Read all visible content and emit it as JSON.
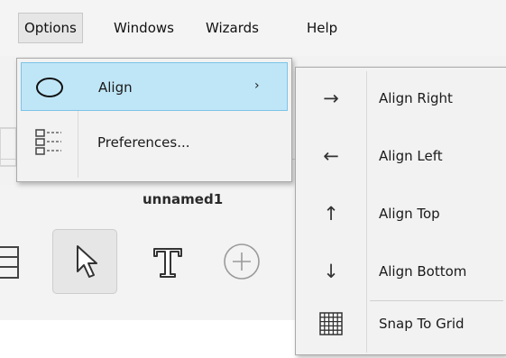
{
  "menubar": {
    "items": [
      {
        "label": "Options",
        "open": true
      },
      {
        "label": "Windows"
      },
      {
        "label": "Wizards"
      },
      {
        "label": "Help"
      }
    ]
  },
  "document": {
    "title": "unnamed1"
  },
  "toolbar": {
    "tools": [
      {
        "name": "select-tool",
        "icon": "cursor-arrow-icon",
        "selected": true
      },
      {
        "name": "text-tool",
        "icon": "text-T-icon",
        "glyph": "T"
      },
      {
        "name": "add-tool",
        "icon": "circle-plus-icon",
        "glyph": "+"
      }
    ]
  },
  "options_menu": {
    "items": [
      {
        "label": "Align",
        "icon": "ellipse-icon",
        "has_submenu": true,
        "highlighted": true
      },
      {
        "label": "Preferences...",
        "icon": "preferences-list-icon"
      }
    ],
    "submenu_arrow": "›"
  },
  "align_submenu": {
    "items": [
      {
        "label": "Align Right",
        "icon": "arrow-right-icon",
        "glyph": "→"
      },
      {
        "label": "Align Left",
        "icon": "arrow-left-icon",
        "glyph": "←"
      },
      {
        "label": "Align Top",
        "icon": "arrow-up-icon",
        "glyph": "↑"
      },
      {
        "label": "Align Bottom",
        "icon": "arrow-down-icon",
        "glyph": "↓"
      },
      {
        "label": "Snap To Grid",
        "icon": "grid-icon"
      }
    ]
  },
  "colors": {
    "highlight_bg": "#bfe6f7",
    "highlight_border": "#7dc4e8",
    "menu_bg": "#f2f2f2"
  }
}
